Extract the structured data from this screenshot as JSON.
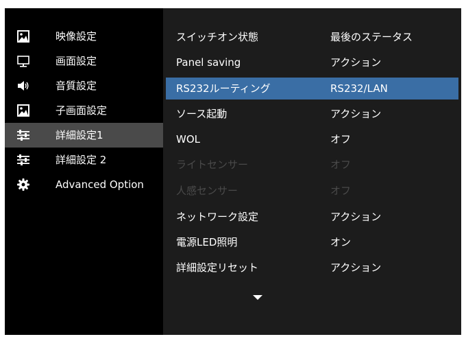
{
  "menu": {
    "items": [
      {
        "label": "映像設定",
        "icon": "picture-icon"
      },
      {
        "label": "画面設定",
        "icon": "monitor-icon"
      },
      {
        "label": "音質設定",
        "icon": "speaker-icon"
      },
      {
        "label": "子画面設定",
        "icon": "pip-picture-icon"
      },
      {
        "label": "詳細設定1",
        "icon": "sliders-icon"
      },
      {
        "label": "詳細設定 2",
        "icon": "sliders-icon"
      },
      {
        "label": "Advanced Option",
        "icon": "gear-icon"
      }
    ],
    "selected_index": 4
  },
  "settings": {
    "rows": [
      {
        "name": "スイッチオン状態",
        "value": "最後のステータス"
      },
      {
        "name": "Panel saving",
        "value": "アクション"
      },
      {
        "name": "RS232ルーティング",
        "value": "RS232/LAN"
      },
      {
        "name": "ソース起動",
        "value": "アクション"
      },
      {
        "name": "WOL",
        "value": "オフ"
      },
      {
        "name": "ライトセンサー",
        "value": "オフ"
      },
      {
        "name": "人感センサー",
        "value": "オフ"
      },
      {
        "name": "ネットワーク設定",
        "value": "アクション"
      },
      {
        "name": "電源LED照明",
        "value": "オン"
      },
      {
        "name": "詳細設定リセット",
        "value": "アクション"
      }
    ],
    "highlight_index": 2,
    "disabled_indices": [
      5,
      6
    ]
  },
  "scroll_indicator_icon": "triangle-down-icon",
  "colors": {
    "background": "#000000",
    "panel": "#1c1c1c",
    "highlight": "#3a6ea5",
    "menu_selected": "#4a4a4a",
    "text": "#ffffff",
    "disabled_text": "#4a4a4a"
  }
}
